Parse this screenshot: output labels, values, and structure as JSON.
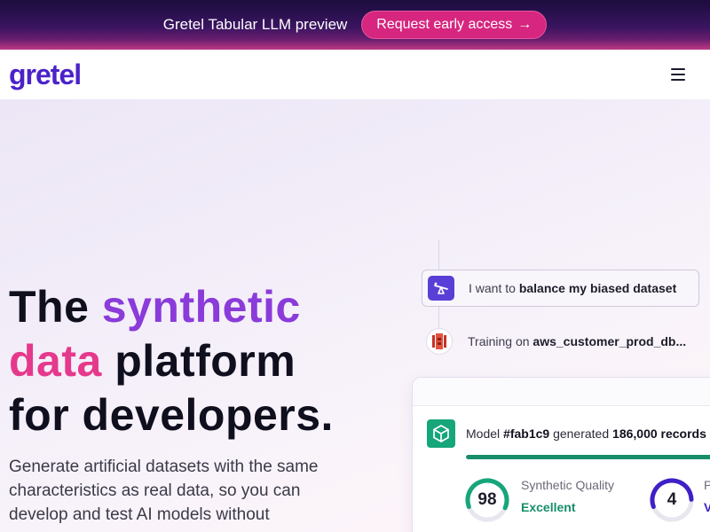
{
  "banner": {
    "text": "Gretel Tabular LLM preview",
    "button_label": "Request early access",
    "button_arrow": "→"
  },
  "nav": {
    "logo": "gretel",
    "menu_icon": "hamburger-menu-icon"
  },
  "hero": {
    "headline_1": "The ",
    "headline_2": "synthetic",
    "headline_3": "data",
    "headline_4": " platform",
    "headline_5": "for developers.",
    "subtext": "Generate artificial datasets with the same characteristics as real data, so you can develop and test AI models without"
  },
  "demo": {
    "prompt_prefix": "I want to ",
    "prompt_bold": "balance my biased dataset",
    "training_prefix": "Training on ",
    "training_bold": "aws_customer_prod_db...",
    "model_prefix": "Model ",
    "model_id": "#fab1c9",
    "model_mid": " generated ",
    "model_records": "186,000 records",
    "progress": 1.0,
    "metric1_score": "98",
    "metric1_label": "Synthetic Quality",
    "metric1_value": "Excellent",
    "metric1_fraction": 0.62,
    "metric2_score": "4",
    "metric2_label": "P",
    "metric2_value": "V",
    "metric2_fraction": 0.55
  },
  "colors": {
    "brand": "#4b22c9",
    "accent_pink": "#d6267f",
    "green": "#17a57a",
    "purple_gauge": "#3f1fc6"
  }
}
